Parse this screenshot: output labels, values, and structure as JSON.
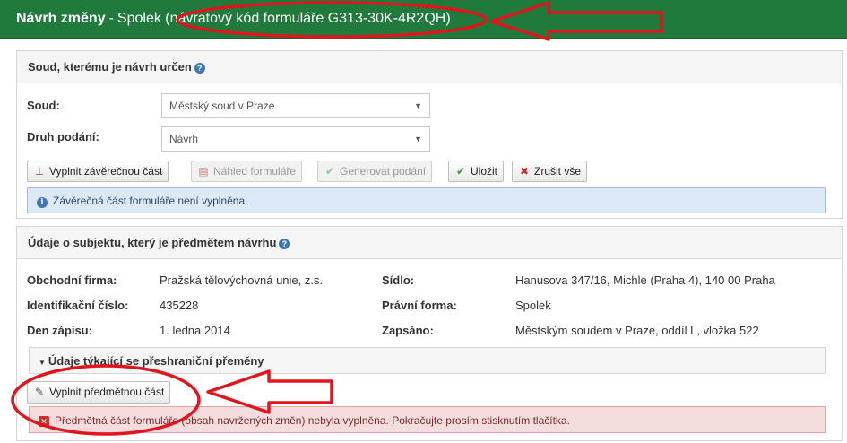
{
  "header": {
    "title_bold": "Návrh změny",
    "separator": "-",
    "subtitle": "Spolek (návratový kód formuláře G313-30K-4R2QH)"
  },
  "court_panel": {
    "heading": "Soud, kterému je návrh určen",
    "court_label": "Soud:",
    "court_value": "Městský soud v Praze",
    "type_label": "Druh podání:",
    "type_value": "Návrh",
    "buttons": {
      "fill_final": "Vyplnit závěrečnou část",
      "preview": "Náhled formuláře",
      "generate": "Generovat podání",
      "save": "Uložit",
      "cancel_all": "Zrušit vše"
    },
    "info": "Závěrečná část formuláře není vyplněna."
  },
  "subject_panel": {
    "heading": "Údaje o subjektu, který je předmětem návrhu",
    "fields": {
      "firm_label": "Obchodní firma:",
      "firm_value": "Pražská tělovýchovná unie, z.s.",
      "id_label": "Identifikační číslo:",
      "id_value": "435228",
      "date_label": "Den zápisu:",
      "date_value": "1. ledna 2014",
      "seat_label": "Sídlo:",
      "seat_value": "Hanusova 347/16, Michle (Praha 4), 140 00 Praha",
      "legal_label": "Právní forma:",
      "legal_value": "Spolek",
      "reg_label": "Zapsáno:",
      "reg_value": "Městským soudem v Praze, oddíl L, vložka 522"
    },
    "cross_border_heading": "Údaje týkající se přeshraniční přeměny",
    "fill_subject_button": "Vyplnit předmětnou část",
    "warning": "Předmětná část formuláře (obsah navržených změn) nebyla vyplněna. Pokračujte prosím stisknutím tlačítka."
  },
  "colors": {
    "header_green": "#1f7a3c",
    "annotation_red": "#e0161e",
    "info_blue": "#dde9f7",
    "danger_red": "#f6dddd"
  }
}
